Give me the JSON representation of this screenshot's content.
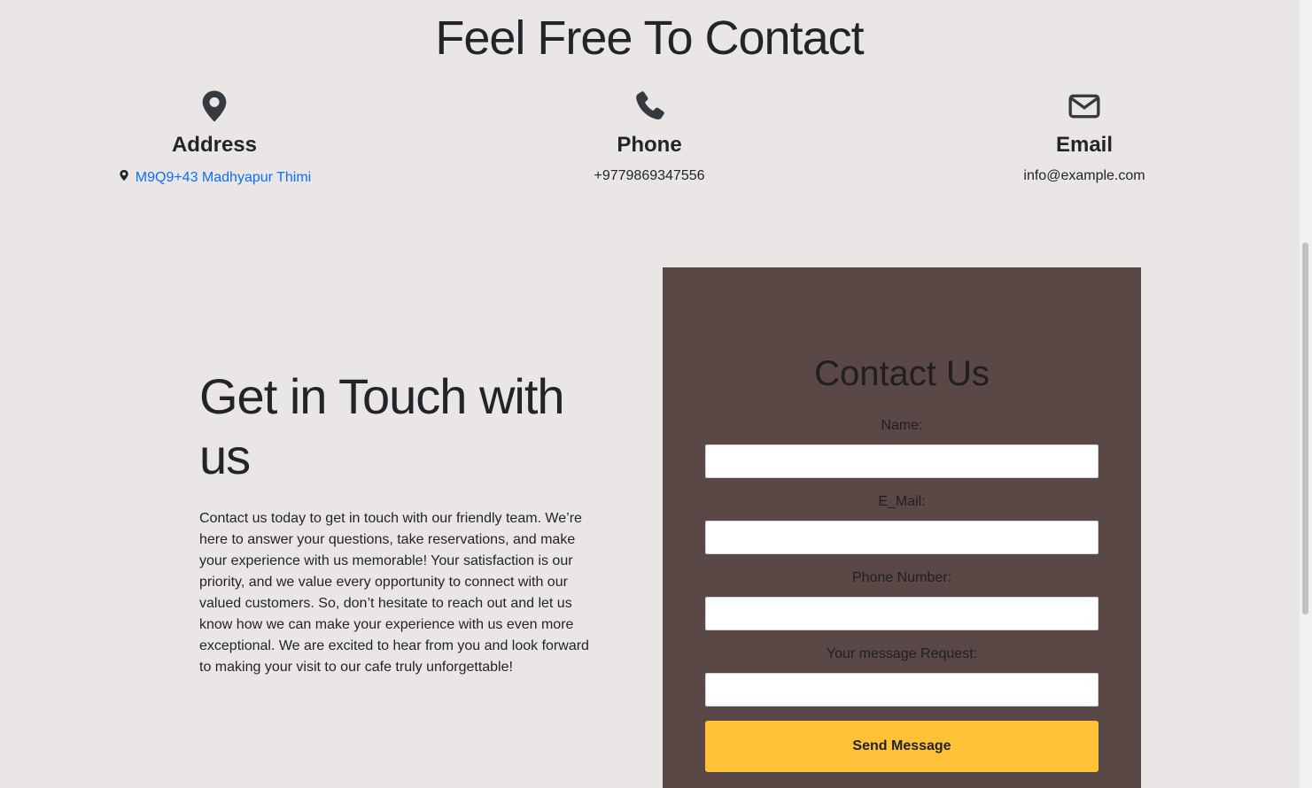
{
  "header": {
    "title": "Feel Free To Contact"
  },
  "info": {
    "address": {
      "icon": "map-pin-icon",
      "title": "Address",
      "value": "M9Q9+43 Madhyapur Thimi"
    },
    "phone": {
      "icon": "phone-icon",
      "title": "Phone",
      "value": "+9779869347556"
    },
    "email": {
      "icon": "envelope-icon",
      "title": "Email",
      "value": "info@example.com"
    }
  },
  "touch": {
    "title": "Get in Touch with us",
    "text": "Contact us today to get in touch with our friendly team. We’re here to answer your questions, take reservations, and make your experience with us memorable! Your satisfaction is our priority, and we value every opportunity to connect with our valued customers. So, don’t hesitate to reach out and let us know how we can make your experience with us even more exceptional. We are excited to hear from you and look forward to making your visit to our cafe truly unforgettable!"
  },
  "form": {
    "title": "Contact Us",
    "fields": [
      {
        "label": "Name:",
        "value": ""
      },
      {
        "label": "E_Mail:",
        "value": ""
      },
      {
        "label": "Phone Number:",
        "value": ""
      },
      {
        "label": "Your message Request:",
        "value": ""
      }
    ],
    "submit_label": "Send Message"
  },
  "colors": {
    "background": "#ebe6e6",
    "form_panel": "#594846",
    "button": "#ffc138",
    "link": "#0d6efd"
  }
}
